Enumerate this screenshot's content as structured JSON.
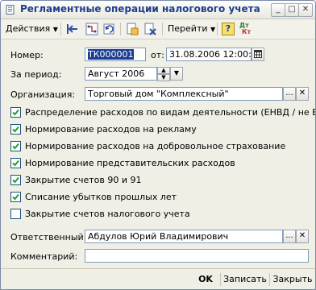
{
  "window": {
    "title": "Регламентные операции налогового учета",
    "minimize_glyph": "_",
    "maximize_glyph": "□",
    "close_glyph": "✕"
  },
  "toolbar": {
    "actions_label": "Действия",
    "goto_label": "Перейти",
    "help_glyph": "?",
    "dtkt_top": "Дт",
    "dtkt_bottom": "Кт"
  },
  "form": {
    "number_label": "Номер:",
    "number_value": "ТК000001",
    "from_label": "от:",
    "date_value": "31.08.2006 12:00:00",
    "period_label": "За период:",
    "period_value": "Август 2006",
    "org_label": "Организация:",
    "org_value": "Торговый дом \"Комплексный\"",
    "responsible_label": "Ответственный:",
    "responsible_value": "Абдулов Юрий Владимирович",
    "comment_label": "Комментарий:",
    "comment_value": "",
    "select_glyph": "...",
    "clear_glyph": "✕"
  },
  "checkboxes": [
    {
      "label": "Распределение расходов по видам деятельности (ЕНВД / не ЕНВД)",
      "checked": true
    },
    {
      "label": "Нормирование расходов на рекламу",
      "checked": true
    },
    {
      "label": "Нормирование расходов на добровольное страхование",
      "checked": true
    },
    {
      "label": "Нормирование представительских расходов",
      "checked": true
    },
    {
      "label": "Закрытие счетов 90 и 91",
      "checked": true
    },
    {
      "label": "Списание убытков прошлых лет",
      "checked": true
    },
    {
      "label": "Закрытие счетов налогового учета",
      "checked": false
    }
  ],
  "buttons": {
    "ok": "OK",
    "save": "Записать",
    "close": "Закрыть"
  }
}
